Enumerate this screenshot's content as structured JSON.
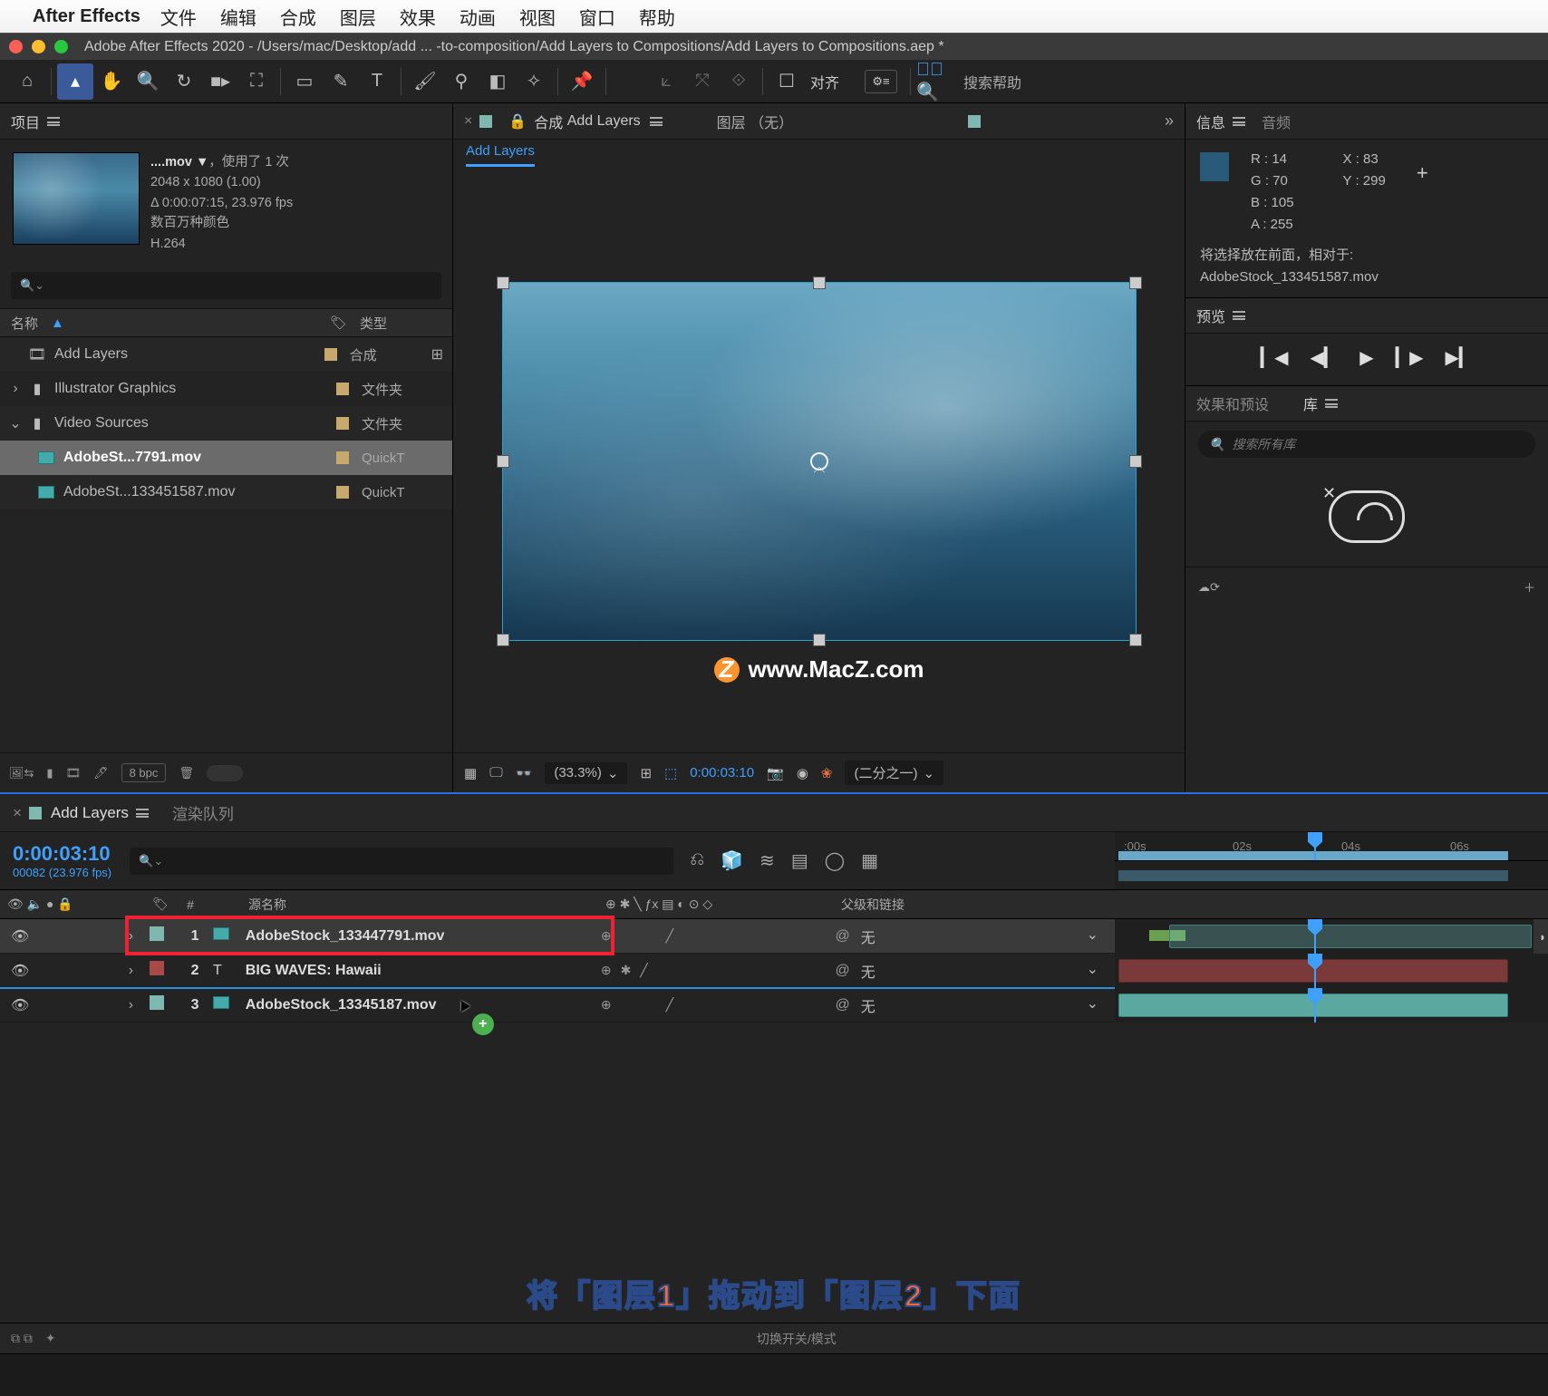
{
  "mac_menu": {
    "app": "After Effects",
    "items": [
      "文件",
      "编辑",
      "合成",
      "图层",
      "效果",
      "动画",
      "视图",
      "窗口",
      "帮助"
    ]
  },
  "titlebar": "Adobe After Effects 2020 - /Users/mac/Desktop/add ... -to-composition/Add Layers to Compositions/Add Layers to Compositions.aep *",
  "toolbar": {
    "align": "对齐",
    "search": "搜索帮助"
  },
  "project": {
    "tab": "项目",
    "info_name": "....mov ▼",
    "info_used": "，使用了 1 次",
    "info_dim": "2048 x 1080 (1.00)",
    "info_dur": "Δ 0:00:07:15, 23.976 fps",
    "info_color": "数百万种颜色",
    "info_codec": "H.264",
    "col_name": "名称",
    "col_type": "类型",
    "rows": [
      {
        "name": "Add Layers",
        "type": "合成",
        "icon": "comp",
        "color": "#c7a96b"
      },
      {
        "name": "Illustrator Graphics",
        "type": "文件夹",
        "icon": "folder",
        "color": "#c7a96b"
      },
      {
        "name": "Video Sources",
        "type": "文件夹",
        "icon": "folder-open",
        "color": "#c7a96b"
      },
      {
        "name": "AdobeSt...7791.mov",
        "type": "QuickT",
        "icon": "mov",
        "color": "#c7a96b",
        "sel": true,
        "indent": 1
      },
      {
        "name": "AdobeSt...133451587.mov",
        "type": "QuickT",
        "icon": "mov",
        "color": "#c7a96b",
        "indent": 1
      }
    ],
    "bpc": "8 bpc"
  },
  "comp": {
    "tab_label": "合成",
    "tab_name": "Add Layers",
    "tab_layer": "图层  （无）",
    "sub": "Add Layers",
    "watermark": "www.MacZ.com",
    "zoom": "(33.3%)",
    "tc": "0:00:03:10",
    "res": "(二分之一)"
  },
  "right": {
    "info_tab": "信息",
    "audio_tab": "音频",
    "r": "R :  14",
    "g": "G :  70",
    "b": "B :  105",
    "a": "A :  255",
    "x": "X : 83",
    "y": "Y : 299",
    "msg1": "将选择放在前面，相对于:",
    "msg2": "AdobeStock_133451587.mov",
    "preview_tab": "预览",
    "fx_tab": "效果和预设",
    "lib_tab": "库",
    "lib_ph": "搜索所有库"
  },
  "timeline": {
    "tab": "Add Layers",
    "tab2": "渲染队列",
    "tc": "0:00:03:10",
    "fps": "00082 (23.976 fps)",
    "col_src": "源名称",
    "col_parent": "父级和链接",
    "col_num": "#",
    "ruler": [
      ":00s",
      "02s",
      "04s",
      "06s"
    ],
    "layers": [
      {
        "n": "1",
        "name": "AdobeStock_133447791.mov",
        "parent": "无",
        "color": "#7fb8b0",
        "sel": true
      },
      {
        "n": "2",
        "name": "BIG WAVES: Hawaii",
        "parent": "无",
        "color": "#a84a4a"
      },
      {
        "n": "3",
        "name": "AdobeStock_13345187.mov",
        "parent": "无",
        "color": "#7fb8b0",
        "cursor": true
      }
    ],
    "foot": "切换开关/模式",
    "caption": "将「图层1」拖动到「图层2」下面"
  }
}
